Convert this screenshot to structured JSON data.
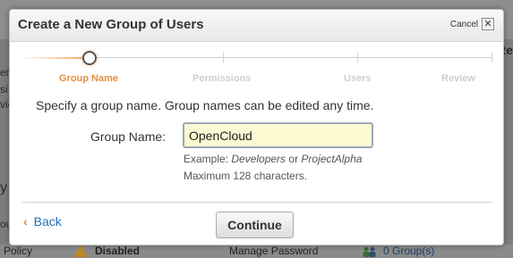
{
  "modal": {
    "title": "Create a New Group of Users",
    "cancel_label": "Cancel",
    "close_glyph": "✕"
  },
  "wizard": {
    "steps": [
      {
        "label": "Group Name",
        "active": true
      },
      {
        "label": "Permissions",
        "active": false
      },
      {
        "label": "Users",
        "active": false
      },
      {
        "label": "Review",
        "active": false
      }
    ]
  },
  "form": {
    "intro": "Specify a group name. Group names can be edited any time.",
    "group_name_label": "Group Name:",
    "group_name_value": "OpenCloud",
    "hint_example_prefix": "Example: ",
    "hint_example_1": "Developers",
    "hint_example_or": " or ",
    "hint_example_2": "ProjectAlpha",
    "hint_max": "Maximum 128 characters."
  },
  "footer": {
    "back_chevron": "‹",
    "back_label": "Back",
    "continue_label": "Continue"
  },
  "background": {
    "left_fragments": [
      "ers",
      "si",
      "vic",
      "y",
      "ou"
    ],
    "right_fragment": "Re",
    "bottom_policy": "Policy",
    "bottom_disabled": "Disabled",
    "bottom_manage_password": "Manage Password",
    "bottom_groups": "0 Group(s)"
  },
  "colors": {
    "accent_orange": "#e88e3d",
    "link_blue": "#1d6fb8",
    "input_bg": "#fbf9d2"
  }
}
